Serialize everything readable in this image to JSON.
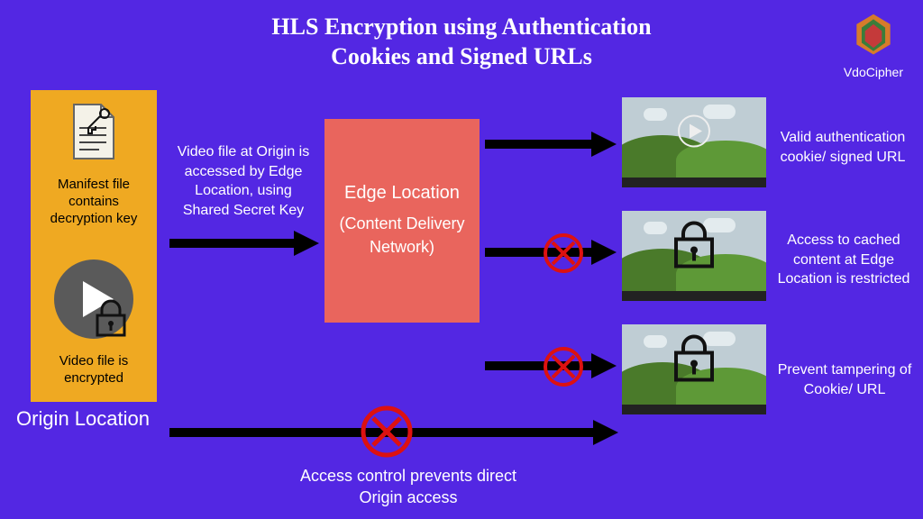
{
  "title_line1": "HLS Encryption using Authentication",
  "title_line2": "Cookies and Signed URLs",
  "brand": "VdoCipher",
  "origin_label": "Origin Location",
  "manifest_text": "Manifest file contains decryption key",
  "video_encrypted_text": "Video file is encrypted",
  "arrow1_text": "Video file at Origin is accessed by Edge Location, using Shared Secret Key",
  "edge_title": "Edge Location",
  "edge_sub": "(Content Delivery Network)",
  "right1_text": "Valid authentication cookie/ signed URL",
  "right2_text": "Access to cached content at Edge Location is restricted",
  "right3_text": "Prevent tampering of  Cookie/ URL",
  "bottom_text": "Access control prevents direct Origin access"
}
